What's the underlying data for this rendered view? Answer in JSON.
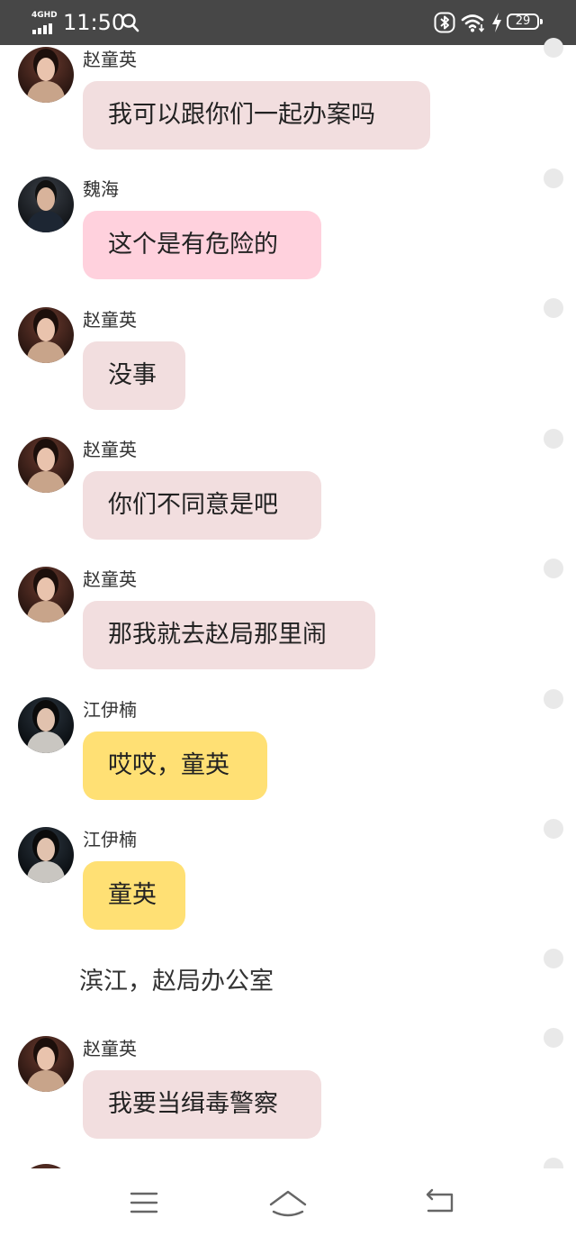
{
  "status_bar": {
    "network": "4GHD",
    "time": "11:50",
    "battery": "29",
    "icons": [
      "signal-icon",
      "search-icon",
      "bluetooth-icon",
      "wifi-icon",
      "charging-icon",
      "battery-icon"
    ]
  },
  "messages": [
    {
      "type": "message",
      "sender": "赵童英",
      "text": "我可以跟你们一起办案吗",
      "avatar": "zhao",
      "bubble_color": "#f2dedf"
    },
    {
      "type": "message",
      "sender": "魏海",
      "text": "这个是有危险的",
      "avatar": "wei",
      "bubble_color": "#ffd1dd"
    },
    {
      "type": "message",
      "sender": "赵童英",
      "text": "没事",
      "avatar": "zhao",
      "bubble_color": "#f2dedf"
    },
    {
      "type": "message",
      "sender": "赵童英",
      "text": "你们不同意是吧",
      "avatar": "zhao",
      "bubble_color": "#f2dedf"
    },
    {
      "type": "message",
      "sender": "赵童英",
      "text": "那我就去赵局那里闹",
      "avatar": "zhao",
      "bubble_color": "#f2dedf"
    },
    {
      "type": "message",
      "sender": "江伊楠",
      "text": "哎哎，童英",
      "avatar": "jiang",
      "bubble_color": "#ffe074"
    },
    {
      "type": "message",
      "sender": "江伊楠",
      "text": "童英",
      "avatar": "jiang",
      "bubble_color": "#ffe074"
    },
    {
      "type": "narration",
      "text": "滨江，赵局办公室"
    },
    {
      "type": "message",
      "sender": "赵童英",
      "text": "我要当缉毒警察",
      "avatar": "zhao",
      "bubble_color": "#f2dedf"
    }
  ],
  "nav_bar": {
    "icons": [
      "menu-icon",
      "home-icon",
      "back-icon"
    ]
  }
}
